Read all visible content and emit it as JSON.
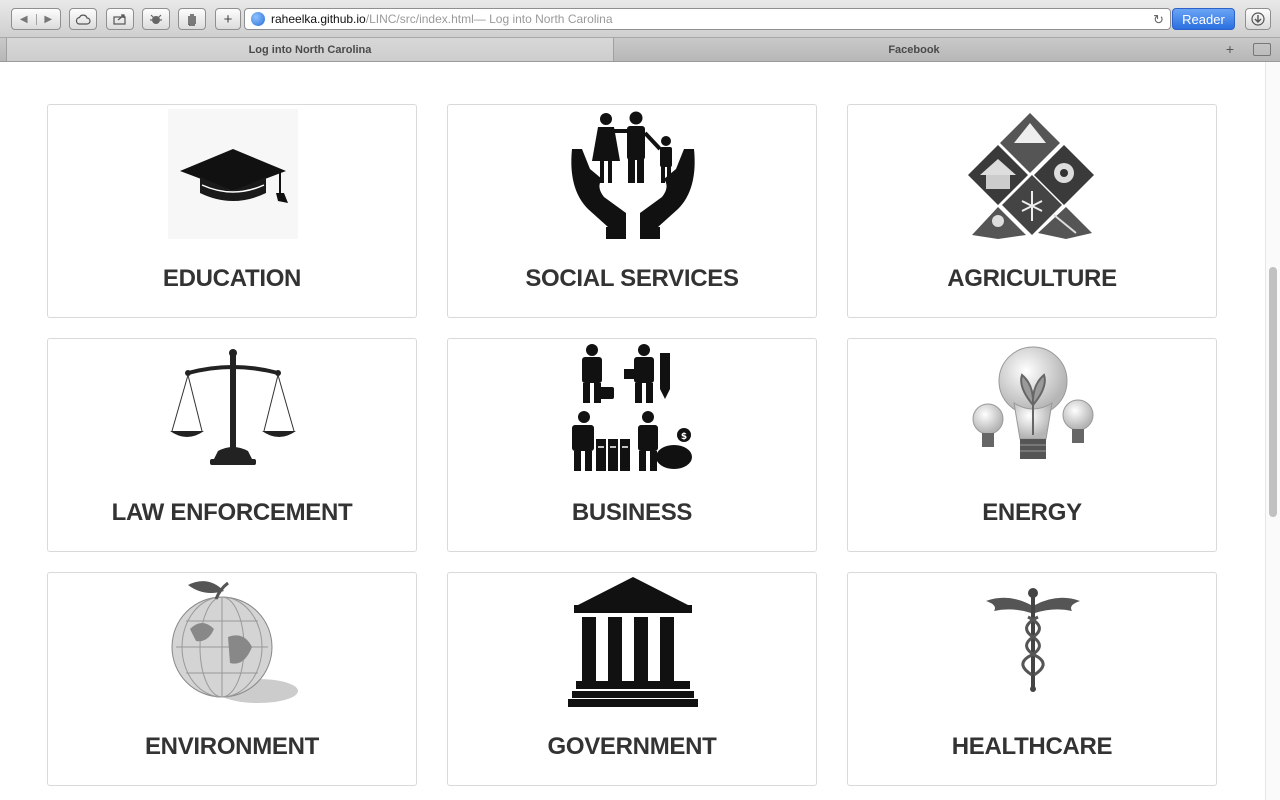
{
  "browser": {
    "url_host": "raheelka.github.io",
    "url_path": "/LINC/src/index.html",
    "url_title": " — Log into North Carolina",
    "reader_label": "Reader",
    "tabs": [
      {
        "label": "Log into North Carolina"
      },
      {
        "label": "Facebook"
      }
    ]
  },
  "categories": [
    {
      "label": "EDUCATION",
      "icon": "graduation-cap-icon"
    },
    {
      "label": "SOCIAL SERVICES",
      "icon": "family-in-hands-icon"
    },
    {
      "label": "AGRICULTURE",
      "icon": "agriculture-diamond-icon"
    },
    {
      "label": "LAW ENFORCEMENT",
      "icon": "scales-of-justice-icon"
    },
    {
      "label": "BUSINESS",
      "icon": "business-people-icon"
    },
    {
      "label": "ENERGY",
      "icon": "light-bulbs-icon"
    },
    {
      "label": "ENVIRONMENT",
      "icon": "globe-apple-icon"
    },
    {
      "label": "GOVERNMENT",
      "icon": "government-building-icon"
    },
    {
      "label": "HEALTHCARE",
      "icon": "caduceus-icon"
    }
  ]
}
